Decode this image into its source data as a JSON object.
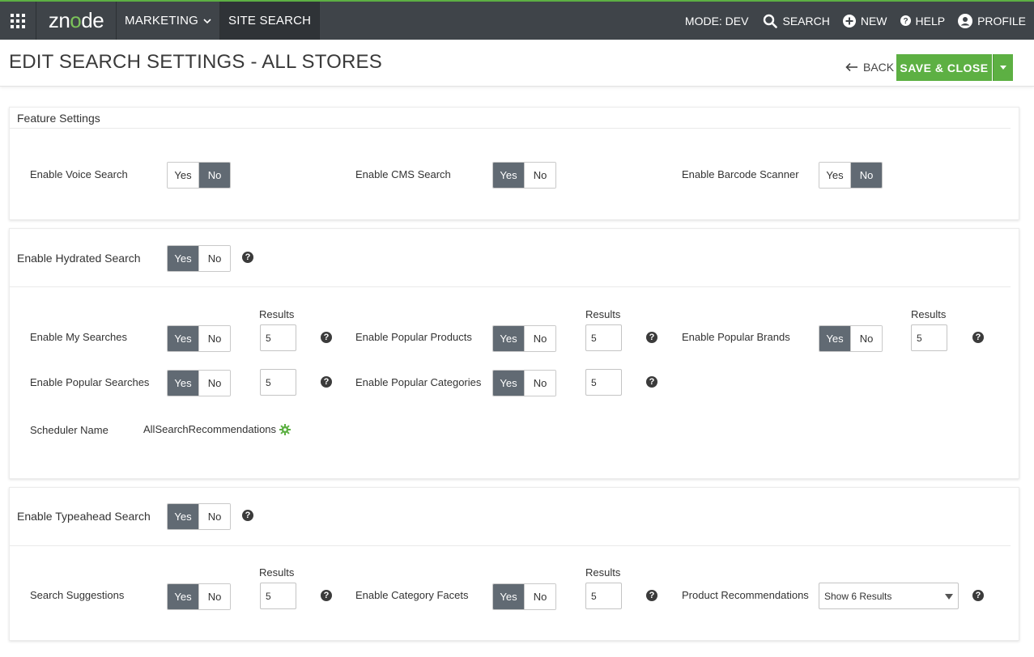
{
  "nav": {
    "logo_a": "zn",
    "logo_o": "o",
    "logo_b": "de",
    "marketing": "Marketing",
    "site_search": "Site Search",
    "mode": "Mode: DEV",
    "search": "Search",
    "new": "New",
    "help": "Help",
    "profile": "Profile"
  },
  "header": {
    "title": "EDIT SEARCH SETTINGS - ALL STORES",
    "back": "Back",
    "save": "Save & Close"
  },
  "feature": {
    "title": "Feature Settings",
    "voice": "Enable Voice Search",
    "cms": "Enable CMS Search",
    "barcode": "Enable Barcode Scanner"
  },
  "hydrated": {
    "title": "Enable Hydrated Search",
    "my_searches": "Enable My Searches",
    "popular_products": "Enable Popular Products",
    "popular_brands": "Enable Popular Brands",
    "popular_searches": "Enable Popular Searches",
    "popular_categories": "Enable Popular Categories",
    "scheduler_label": "Scheduler Name",
    "scheduler_value": "AllSearchRecommendations"
  },
  "typeahead": {
    "title": "Enable Typeahead Search",
    "suggestions": "Search Suggestions",
    "category_facets": "Enable Category Facets",
    "product_recs": "Product Recommendations",
    "product_recs_value": "Show 6 Results"
  },
  "common": {
    "yes": "Yes",
    "no": "No",
    "results": "Results",
    "five": "5",
    "help_glyph": "?"
  },
  "colors": {
    "accent": "#5db043",
    "nav_bg": "#3f4449",
    "toggle_on": "#616a73"
  }
}
